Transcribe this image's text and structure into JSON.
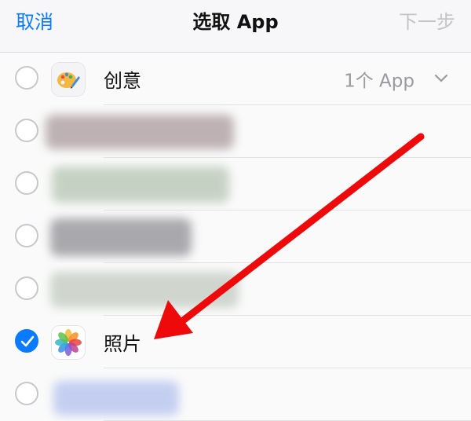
{
  "nav": {
    "cancel": "取消",
    "title": "选取 App",
    "next": "下一步"
  },
  "rows": [
    {
      "label": "创意",
      "count": "1个 App",
      "checked": false,
      "icon": "palette-icon"
    },
    {
      "label": "",
      "checked": false,
      "blurred": true
    },
    {
      "label": "",
      "checked": false,
      "blurred": true
    },
    {
      "label": "",
      "checked": false,
      "blurred": true
    },
    {
      "label": "",
      "checked": false,
      "blurred": true
    },
    {
      "label": "照片",
      "checked": true,
      "icon": "photos-icon"
    },
    {
      "label": "",
      "checked": false,
      "blurred": true
    }
  ],
  "colors": {
    "accent": "#0a7aff",
    "arrow": "#ee0a0a"
  }
}
